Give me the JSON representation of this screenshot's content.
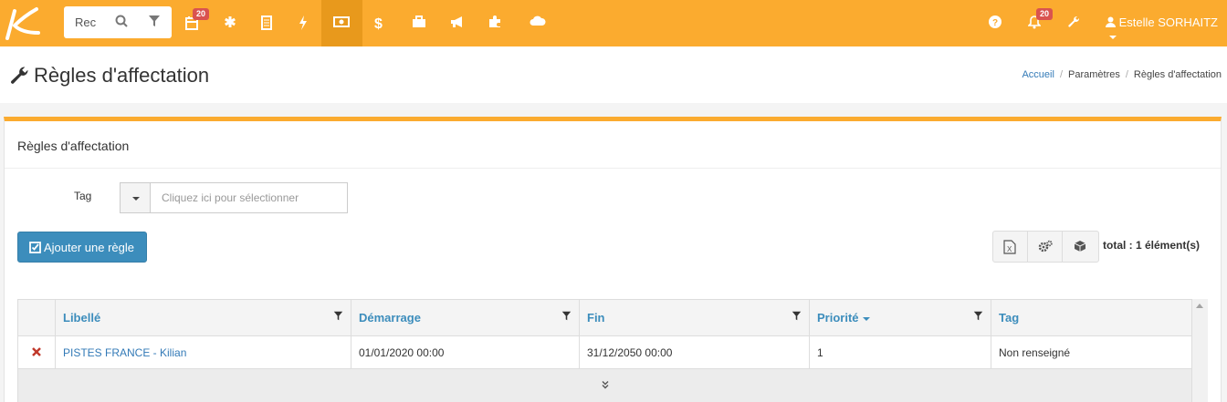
{
  "topbar": {
    "search_placeholder": "Rec",
    "calendar_badge": "20",
    "notif_badge": "20",
    "user_name": "Estelle SORHAITZ"
  },
  "page": {
    "title": "Règles d'affectation",
    "breadcrumb": [
      "Accueil",
      "Paramètres",
      "Règles d'affectation"
    ]
  },
  "box": {
    "title": "Règles d'affectation",
    "tag_label": "Tag",
    "tag_placeholder": "Cliquez ici pour sélectionner",
    "add_button": "Ajouter une règle",
    "total": "total : 1 élément(s)"
  },
  "table": {
    "headers": [
      "Libellé",
      "Démarrage",
      "Fin",
      "Priorité",
      "Tag"
    ],
    "rows": [
      {
        "libelle": "PISTES FRANCE - Kilian",
        "demarrage": "01/01/2020 00:00",
        "fin": "31/12/2050 00:00",
        "priorite": "1",
        "tag": "Non renseigné"
      }
    ]
  },
  "colors": {
    "topbar": "#fbab2f",
    "primary": "#3c8dbc",
    "danger": "#c0392b"
  }
}
